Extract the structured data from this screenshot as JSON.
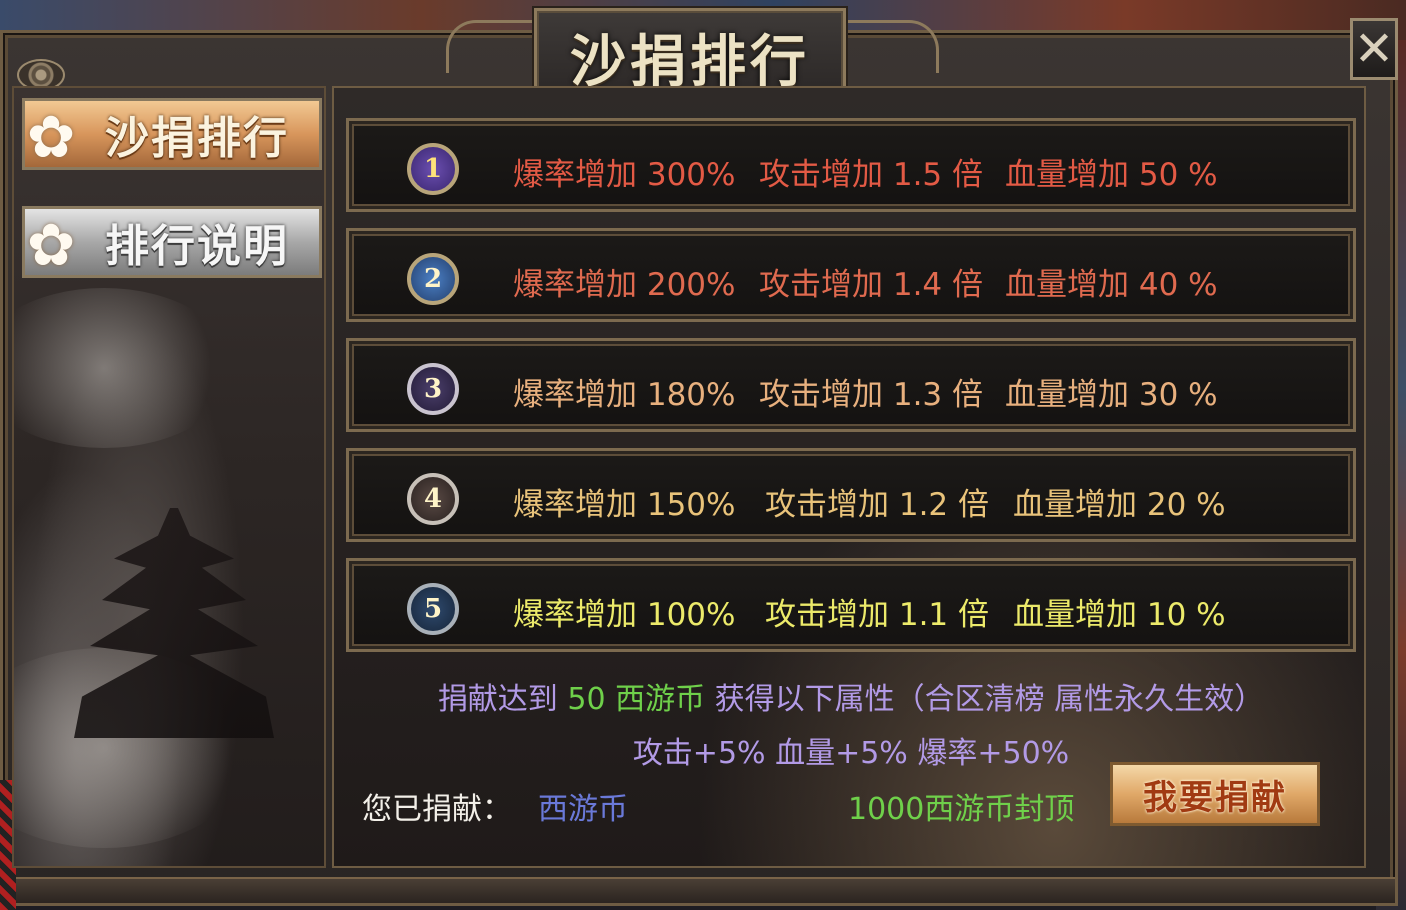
{
  "title": "沙捐排行",
  "close_label": "✕",
  "tabs": [
    {
      "label": "沙捐排行",
      "active": true
    },
    {
      "label": "排行说明",
      "active": false
    }
  ],
  "ranks": [
    {
      "rank": "1",
      "drop": "爆率增加 300%",
      "attack": "攻击增加 1.5 倍",
      "hp": "血量增加 50 %",
      "color": "#e35a45"
    },
    {
      "rank": "2",
      "drop": "爆率增加 200%",
      "attack": "攻击增加 1.4 倍",
      "hp": "血量增加 40 %",
      "color": "#e06a4f"
    },
    {
      "rank": "3",
      "drop": "爆率增加 180%",
      "attack": "攻击增加 1.3 倍",
      "hp": "血量增加 30 %",
      "color": "#e8b07e"
    },
    {
      "rank": "4",
      "drop": "爆率增加 150%",
      "attack": "攻击增加 1.2 倍",
      "hp": "血量增加 20 %",
      "color": "#e9c37a"
    },
    {
      "rank": "5",
      "drop": "爆率增加 100%",
      "attack": "攻击增加 1.1 倍",
      "hp": "血量增加 10 %",
      "color": "#ecea6a"
    }
  ],
  "info": {
    "line1_a": "捐献达到",
    "line1_amount": "50 西游币",
    "line1_b": "获得以下属性（合区清榜 属性永久生效）",
    "line2": "攻击+5% 血量+5% 爆率+50%",
    "donated_label": "您已捐献：",
    "donated_value": "西游币",
    "cap": "1000西游币封顶"
  },
  "donate_button": "我要捐献",
  "colors": {
    "purple": "#b29ae6",
    "green": "#6fd04a",
    "blue": "#6a79d8",
    "frame": "#8d7a5c"
  }
}
